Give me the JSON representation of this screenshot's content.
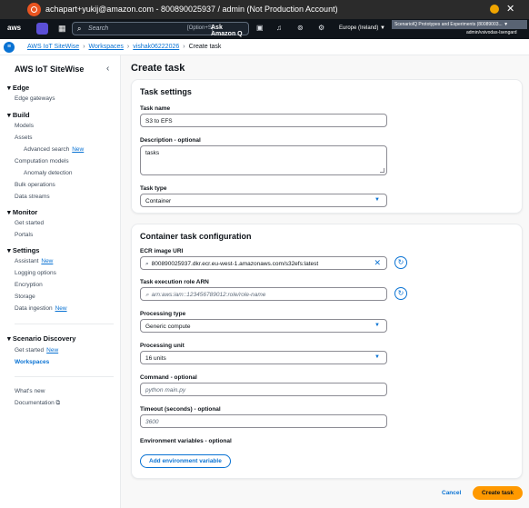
{
  "window": {
    "title": "achapart+yukij@amazon.com - 800890025937 / admin (Not Production Account)"
  },
  "top_nav": {
    "logo": "aws",
    "search_placeholder": "Search",
    "search_shortcut": "[Option+S]",
    "ask_q": "Ask Amazon Q",
    "region": "Europe (Ireland) ▼",
    "account": "ScenarioIQ Prototypes and Experiments (80089003... ▼",
    "user": "admin/vsivodas-Isengard"
  },
  "breadcrumbs": [
    {
      "label": "AWS IoT SiteWise"
    },
    {
      "label": "Workspaces"
    },
    {
      "label": "vishak06222026"
    },
    {
      "label": "Create task"
    }
  ],
  "sidebar": {
    "title": "AWS IoT SiteWise",
    "sections": {
      "edge": "Edge",
      "build": "Build",
      "monitor": "Monitor",
      "settings": "Settings",
      "scenario": "Scenario Discovery"
    },
    "items": {
      "edge_gateways": "Edge gateways",
      "models": "Models",
      "assets": "Assets",
      "advanced_search": "Advanced search",
      "computation_models": "Computation models",
      "anomaly_detection": "Anomaly detection",
      "bulk_operations": "Bulk operations",
      "data_streams": "Data streams",
      "get_started_monitor": "Get started",
      "portals": "Portals",
      "assistant": "Assistant",
      "logging_options": "Logging options",
      "encryption": "Encryption",
      "storage": "Storage",
      "data_ingestion": "Data ingestion",
      "get_started_scenario": "Get started",
      "workspaces": "Workspaces",
      "whats_new": "What's new",
      "documentation": "Documentation"
    },
    "new_badge": "New"
  },
  "page": {
    "title": "Create task"
  },
  "task_settings": {
    "heading": "Task settings",
    "name_label": "Task name",
    "name_value": "S3 to EFS",
    "description_label": "Description - optional",
    "description_value": "tasks",
    "type_label": "Task type",
    "type_value": "Container"
  },
  "container_config": {
    "heading": "Container task configuration",
    "ecr_label": "ECR image URI",
    "ecr_value": "800890025937.dkr.ecr.eu-west-1.amazonaws.com/s32efs:latest",
    "role_label": "Task execution role ARN",
    "role_placeholder": "arn:aws:iam::123456789012:role/role-name",
    "processing_type_label": "Processing type",
    "processing_type_value": "Generic compute",
    "processing_unit_label": "Processing unit",
    "processing_unit_value": "16 units",
    "command_label": "Command - optional",
    "command_placeholder": "python main.py",
    "timeout_label": "Timeout (seconds) - optional",
    "timeout_placeholder": "3600",
    "env_label": "Environment variables - optional",
    "add_env_button": "Add environment variable"
  },
  "footer": {
    "cancel": "Cancel",
    "create": "Create task"
  }
}
